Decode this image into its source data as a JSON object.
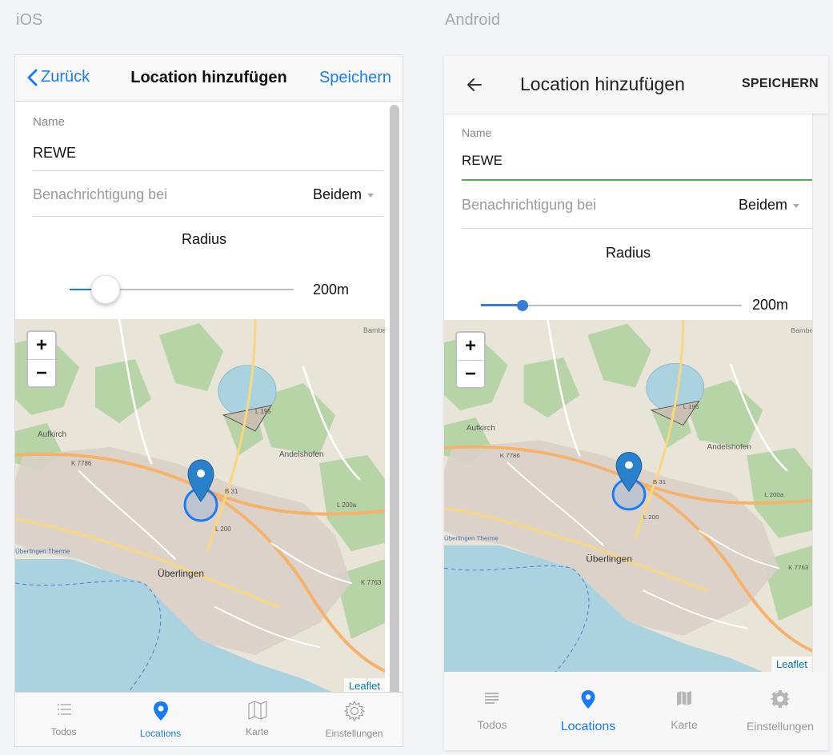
{
  "platforms": {
    "ios": "iOS",
    "android": "Android"
  },
  "ios": {
    "nav": {
      "back_label": "Zurück",
      "title": "Location hinzufügen",
      "save_label": "Speichern"
    },
    "form": {
      "name_label": "Name",
      "name_value": "REWE",
      "notify_label": "Benachrichtigung bei",
      "notify_value": "Beidem",
      "radius_label": "Radius",
      "radius_value": "200m",
      "slider_fraction": 0.16
    },
    "tabs": [
      {
        "label": "Todos",
        "icon": "list-icon"
      },
      {
        "label": "Locations",
        "icon": "location-pin-icon"
      },
      {
        "label": "Karte",
        "icon": "map-icon"
      },
      {
        "label": "Einstellungen",
        "icon": "gear-icon"
      }
    ]
  },
  "android": {
    "nav": {
      "title": "Location hinzufügen",
      "save_label": "SPEICHERN"
    },
    "form": {
      "name_label": "Name",
      "name_value": "REWE",
      "notify_label": "Benachrichtigung bei",
      "notify_value": "Beidem",
      "radius_label": "Radius",
      "radius_value": "200m",
      "slider_fraction": 0.16
    },
    "tabs": [
      {
        "label": "Todos",
        "icon": "list-icon"
      },
      {
        "label": "Locations",
        "icon": "location-pin-icon"
      },
      {
        "label": "Karte",
        "icon": "map-icon"
      },
      {
        "label": "Einstellungen",
        "icon": "gear-icon"
      }
    ]
  },
  "map": {
    "zoom_in": "+",
    "zoom_out": "−",
    "attribution": "Leaflet",
    "place_labels": {
      "city": "Überlingen",
      "aufkirch": "Aufkirch",
      "andelshofen": "Andelshofen",
      "therme": "Überlingen Therme",
      "bambe": "Bambe",
      "b31": "B 31",
      "l200": "L 200",
      "l195": "L 195",
      "k7786": "K 7786",
      "k7763": "K 7763",
      "l200a": "L 200a"
    }
  },
  "colors": {
    "ios_accent": "#1a7cf5",
    "android_accent": "#3a7bd5",
    "android_focus": "#4caf50",
    "water": "#aad3df",
    "forest": "#add19e",
    "urban": "#d9d0c9"
  }
}
